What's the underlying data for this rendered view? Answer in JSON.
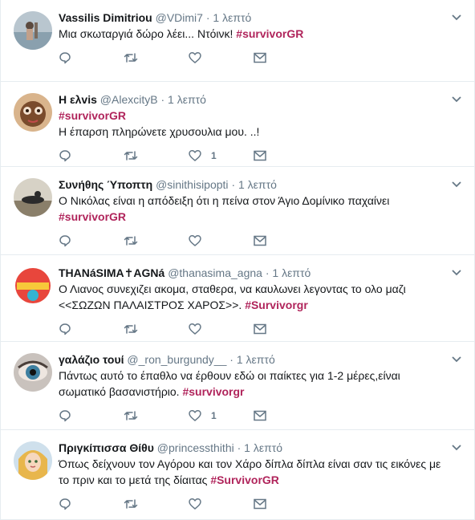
{
  "tweets": [
    {
      "fullname": "Vassilis Dimitriou",
      "username": "@VDimi7",
      "sep": "·",
      "time": "1 λεπτό",
      "text_parts": [
        "Μια σκωταργιά δώρο λέει... Ντόινκ! ",
        "#survivorGR"
      ],
      "likes": ""
    },
    {
      "fullname": "Η ελvis",
      "username": "@AlexcityB",
      "sep": "·",
      "time": "1 λεπτό",
      "text_parts": [
        "#survivorGR",
        "Η έπαρση πληρώνετε χρυσουλια μου. ..!"
      ],
      "likes": "1"
    },
    {
      "fullname": "Συνήθης Ύποπτη",
      "username": "@sinithisipopti",
      "sep": "·",
      "time": "1 λεπτό",
      "text_parts": [
        "Ο Νικόλας είναι η απόδειξη ότι η πείνα στον Άγιο Δομίνικο παχαίνει",
        "#survivorGR"
      ],
      "likes": ""
    },
    {
      "fullname": "THANáSIMA✝AGNá",
      "username": "@thanasima_agna",
      "sep": "·",
      "time": "1 λεπτό",
      "text_parts": [
        "Ο Λιανος συνεχιζει ακομα, σταθερα, να καυλωνει λεγοντας το ολο μαζι",
        "<<ΣΩΖΩΝ ΠΑΛΑΙΣΤΡΟΣ ΧΑΡΟΣ>>. ",
        "#Survivorgr"
      ],
      "likes": ""
    },
    {
      "fullname": "γαλάζιο τουί",
      "username": "@_ron_burgundy__",
      "sep": "·",
      "time": "1 λεπτό",
      "text_parts": [
        "Πάντως αυτό το έπαθλο να έρθουν εδώ οι παίκτες για 1-2 μέρες,είναι",
        "σωματικό βασανιστήριο.  ",
        "#survivorgr"
      ],
      "likes": "1"
    },
    {
      "fullname": "Πριγκίπισσα Θίθυ",
      "username": "@princessthithi",
      "sep": "·",
      "time": "1 λεπτό",
      "text_parts": [
        "Όπως δείχνουν τον Αγόρου και τον Χάρο δίπλα δίπλα είναι σαν τις εικόνες με",
        "το πριν και το μετά της δίαιτας ",
        "#SurvivorGR"
      ],
      "likes": ""
    }
  ],
  "icons": {
    "reply": "reply-icon",
    "retweet": "retweet-icon",
    "like": "heart-icon",
    "dm": "envelope-icon",
    "more": "chevron-down-icon"
  },
  "colors": {
    "hashtag": "#b0245b",
    "meta": "#657786",
    "text": "#14171a",
    "border": "#e6ecf0"
  }
}
